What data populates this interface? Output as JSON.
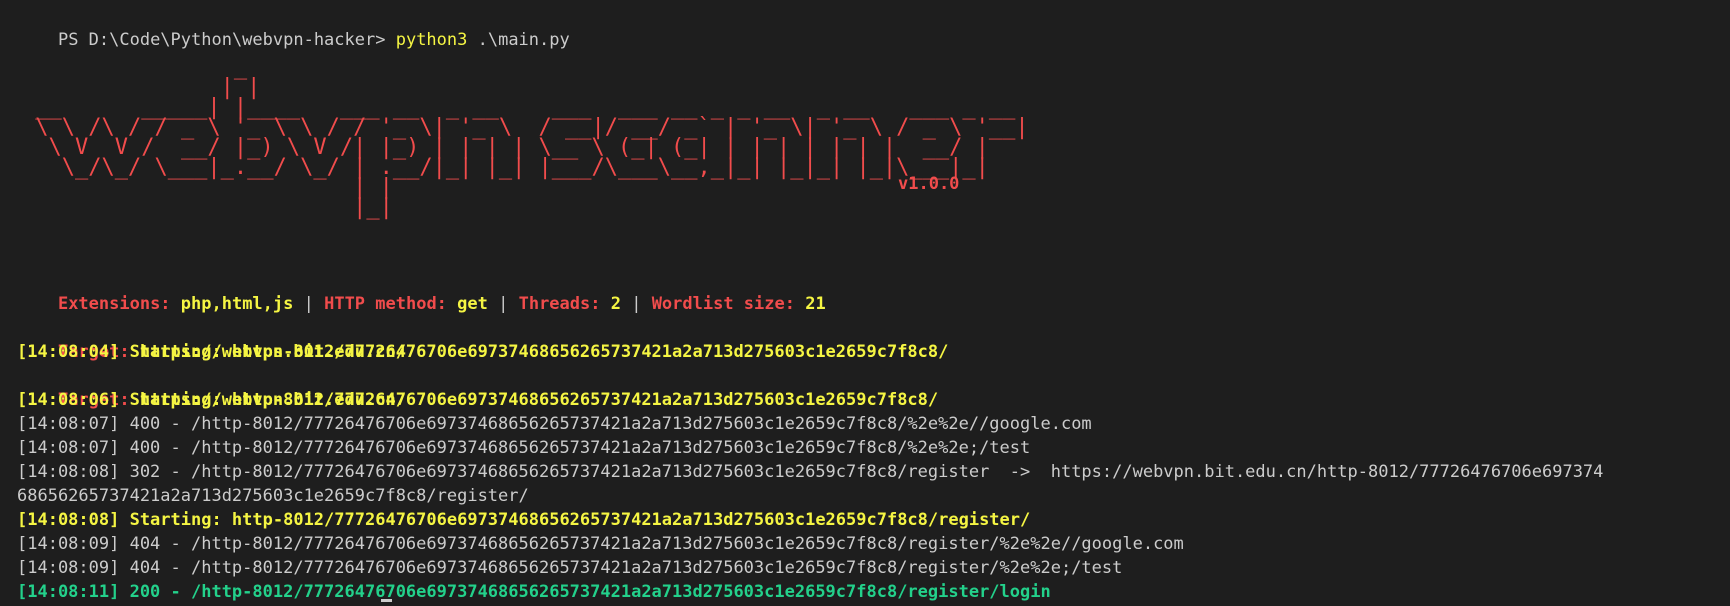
{
  "prompt": {
    "path": "PS D:\\Code\\Python\\webvpn-hacker> ",
    "command": "python3",
    "args": " .\\main.py"
  },
  "banner": {
    "art": "                _\n               | |\n __      _____| |____   ___ __  _ __    ___  ___ __ _ _ __  _ __   ___ _ __\n \\ \\ /\\ / / _ \\ '_ \\ \\ / / '_ \\| '_ \\  / __|/ __/ _` | '_ \\| '_ \\ / _ \\ '__|\n  \\ V  V /  __/ |_) \\ V /| |_) | | | | \\__ \\ (_| (_| | | | | | | |  __/ |\n   \\_/\\_/ \\___|_.__/ \\_/ | .__/|_| |_| |___/\\___\\__,_|_| |_|_| |_|\\___|_|\n                         | |\n                         |_|",
    "version": "v1.0.0"
  },
  "config": {
    "extensions_label": "Extensions: ",
    "extensions_value": "php,html,js",
    "sep": " | ",
    "method_label": "HTTP method: ",
    "method_value": "get",
    "threads_label": "Threads: ",
    "threads_value": "2",
    "wordlist_label": "Wordlist size: ",
    "wordlist_value": "21"
  },
  "log": {
    "target_label": "Target: ",
    "target_url": "https://webvpn.bit.edu.cn/",
    "l1": "[14:08:04] Starting: https-8012/77726476706e69737468656265737421a2a713d275603c1e2659c7f8c8/",
    "l3": "[14:08:06] Starting: http-8012/77726476706e69737468656265737421a2a713d275603c1e2659c7f8c8/",
    "l4": "[14:08:07] 400 - /http-8012/77726476706e69737468656265737421a2a713d275603c1e2659c7f8c8/%2e%2e//google.com",
    "l5": "[14:08:07] 400 - /http-8012/77726476706e69737468656265737421a2a713d275603c1e2659c7f8c8/%2e%2e;/test",
    "l6a": "[14:08:08] 302 - /http-8012/77726476706e69737468656265737421a2a713d275603c1e2659c7f8c8/register  ->  https://webvpn.bit.edu.cn/http-8012/77726476706e697374",
    "l6b": "68656265737421a2a713d275603c1e2659c7f8c8/register/",
    "l7": "[14:08:08] Starting: http-8012/77726476706e69737468656265737421a2a713d275603c1e2659c7f8c8/register/",
    "l8": "[14:08:09] 404 - /http-8012/77726476706e69737468656265737421a2a713d275603c1e2659c7f8c8/register/%2e%2e//google.com",
    "l9": "[14:08:09] 404 - /http-8012/77726476706e69737468656265737421a2a713d275603c1e2659c7f8c8/register/%2e%2e;/test",
    "l10": "[14:08:11] 200 - /http-8012/77726476706e69737468656265737421a2a713d275603c1e2659c7f8c8/register/login"
  }
}
